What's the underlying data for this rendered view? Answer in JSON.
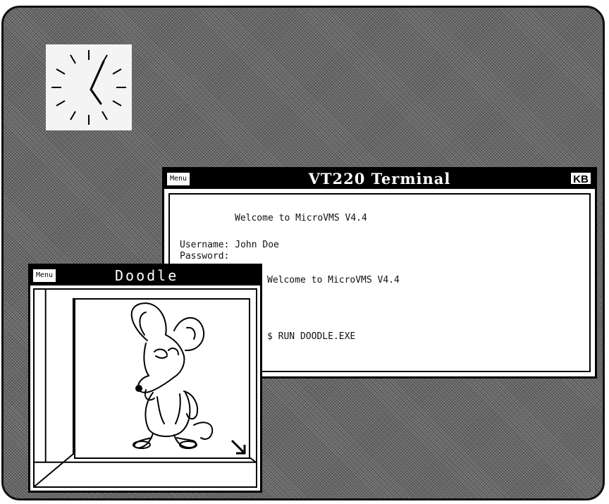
{
  "terminal": {
    "title": "VT220 Terminal",
    "menu_label": "Menu",
    "kb_label": "KB",
    "lines": [
      "Welcome to MicroVMS V4.4",
      "Username: John Doe",
      "Password:",
      "Welcome to MicroVMS V4.4",
      "$ RUN DOODLE.EXE"
    ]
  },
  "doodle": {
    "title": "Doodle",
    "menu_label": "Menu"
  },
  "icons": [
    "analog-clock",
    "mouse-drawing",
    "resize-arrow-icon"
  ]
}
